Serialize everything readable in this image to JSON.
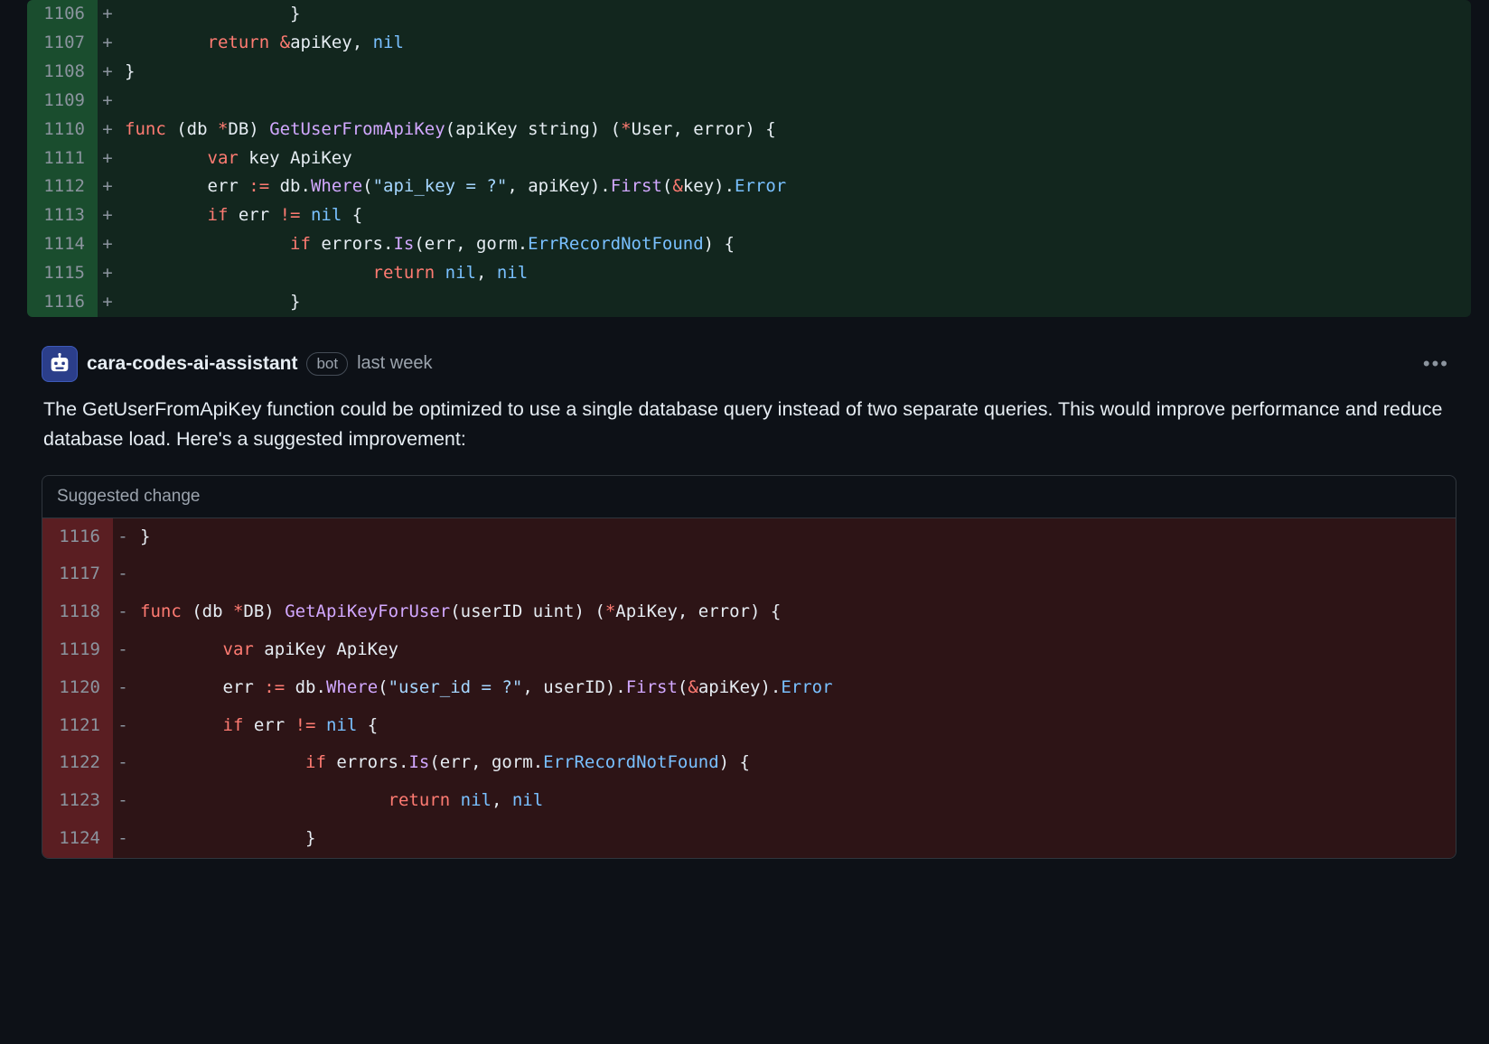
{
  "diff": {
    "lines": [
      {
        "num": "1106",
        "mark": "+",
        "cls": "added",
        "tokens": [
          {
            "t": "                }",
            "c": ""
          }
        ]
      },
      {
        "num": "1107",
        "mark": "+",
        "cls": "added",
        "tokens": [
          {
            "t": "        ",
            "c": ""
          },
          {
            "t": "return",
            "c": "tok-kw"
          },
          {
            "t": " ",
            "c": ""
          },
          {
            "t": "&",
            "c": "tok-op"
          },
          {
            "t": "apiKey, ",
            "c": ""
          },
          {
            "t": "nil",
            "c": "tok-id"
          }
        ]
      },
      {
        "num": "1108",
        "mark": "+",
        "cls": "added",
        "tokens": [
          {
            "t": "}",
            "c": ""
          }
        ]
      },
      {
        "num": "1109",
        "mark": "+",
        "cls": "added",
        "tokens": [
          {
            "t": "",
            "c": ""
          }
        ]
      },
      {
        "num": "1110",
        "mark": "+",
        "cls": "added",
        "tokens": [
          {
            "t": "func",
            "c": "tok-kw"
          },
          {
            "t": " (db ",
            "c": ""
          },
          {
            "t": "*",
            "c": "tok-op"
          },
          {
            "t": "DB) ",
            "c": ""
          },
          {
            "t": "GetUserFromApiKey",
            "c": "tok-fn"
          },
          {
            "t": "(apiKey string) (",
            "c": ""
          },
          {
            "t": "*",
            "c": "tok-op"
          },
          {
            "t": "User, error) {",
            "c": ""
          }
        ]
      },
      {
        "num": "1111",
        "mark": "+",
        "cls": "added",
        "tokens": [
          {
            "t": "        ",
            "c": ""
          },
          {
            "t": "var",
            "c": "tok-kw"
          },
          {
            "t": " key ApiKey",
            "c": ""
          }
        ]
      },
      {
        "num": "1112",
        "mark": "+",
        "cls": "added",
        "tokens": [
          {
            "t": "        err ",
            "c": ""
          },
          {
            "t": ":=",
            "c": "tok-op"
          },
          {
            "t": " db.",
            "c": ""
          },
          {
            "t": "Where",
            "c": "tok-fn"
          },
          {
            "t": "(",
            "c": ""
          },
          {
            "t": "\"api_key = ?\"",
            "c": "tok-str"
          },
          {
            "t": ", apiKey).",
            "c": ""
          },
          {
            "t": "First",
            "c": "tok-fn"
          },
          {
            "t": "(",
            "c": ""
          },
          {
            "t": "&",
            "c": "tok-op"
          },
          {
            "t": "key).",
            "c": ""
          },
          {
            "t": "Error",
            "c": "tok-id"
          }
        ]
      },
      {
        "num": "1113",
        "mark": "+",
        "cls": "added",
        "tokens": [
          {
            "t": "        ",
            "c": ""
          },
          {
            "t": "if",
            "c": "tok-kw"
          },
          {
            "t": " err ",
            "c": ""
          },
          {
            "t": "!=",
            "c": "tok-op"
          },
          {
            "t": " ",
            "c": ""
          },
          {
            "t": "nil",
            "c": "tok-id"
          },
          {
            "t": " {",
            "c": ""
          }
        ]
      },
      {
        "num": "1114",
        "mark": "+",
        "cls": "added",
        "tokens": [
          {
            "t": "                ",
            "c": ""
          },
          {
            "t": "if",
            "c": "tok-kw"
          },
          {
            "t": " errors.",
            "c": ""
          },
          {
            "t": "Is",
            "c": "tok-fn"
          },
          {
            "t": "(err, gorm.",
            "c": ""
          },
          {
            "t": "ErrRecordNotFound",
            "c": "tok-id"
          },
          {
            "t": ") {",
            "c": ""
          }
        ]
      },
      {
        "num": "1115",
        "mark": "+",
        "cls": "added",
        "tokens": [
          {
            "t": "                        ",
            "c": ""
          },
          {
            "t": "return",
            "c": "tok-kw"
          },
          {
            "t": " ",
            "c": ""
          },
          {
            "t": "nil",
            "c": "tok-id"
          },
          {
            "t": ", ",
            "c": ""
          },
          {
            "t": "nil",
            "c": "tok-id"
          }
        ]
      },
      {
        "num": "1116",
        "mark": "+",
        "cls": "added",
        "tokens": [
          {
            "t": "                }",
            "c": ""
          }
        ]
      }
    ]
  },
  "comment": {
    "author": "cara-codes-ai-assistant",
    "bot_label": "bot",
    "timestamp": "last week",
    "body": "The GetUserFromApiKey function could be optimized to use a single database query instead of two separate queries. This would improve performance and reduce database load. Here's a suggested improvement:",
    "suggestion_label": "Suggested change",
    "suggestion_lines": [
      {
        "num": "1116",
        "mark": "-",
        "cls": "removed",
        "tokens": [
          {
            "t": "}",
            "c": ""
          }
        ]
      },
      {
        "num": "1117",
        "mark": "-",
        "cls": "removed",
        "tokens": [
          {
            "t": "",
            "c": ""
          }
        ]
      },
      {
        "num": "1118",
        "mark": "-",
        "cls": "removed",
        "tokens": [
          {
            "t": "func",
            "c": "tok-kw"
          },
          {
            "t": " (db ",
            "c": ""
          },
          {
            "t": "*",
            "c": "tok-op"
          },
          {
            "t": "DB) ",
            "c": ""
          },
          {
            "t": "GetApiKeyForUser",
            "c": "tok-fn"
          },
          {
            "t": "(userID uint) (",
            "c": ""
          },
          {
            "t": "*",
            "c": "tok-op"
          },
          {
            "t": "ApiKey, error) {",
            "c": ""
          }
        ]
      },
      {
        "num": "1119",
        "mark": "-",
        "cls": "removed",
        "tokens": [
          {
            "t": "        ",
            "c": ""
          },
          {
            "t": "var",
            "c": "tok-kw"
          },
          {
            "t": " apiKey ApiKey",
            "c": ""
          }
        ]
      },
      {
        "num": "1120",
        "mark": "-",
        "cls": "removed",
        "tokens": [
          {
            "t": "        err ",
            "c": ""
          },
          {
            "t": ":=",
            "c": "tok-op"
          },
          {
            "t": " db.",
            "c": ""
          },
          {
            "t": "Where",
            "c": "tok-fn"
          },
          {
            "t": "(",
            "c": ""
          },
          {
            "t": "\"user_id = ?\"",
            "c": "tok-str"
          },
          {
            "t": ", userID).",
            "c": ""
          },
          {
            "t": "First",
            "c": "tok-fn"
          },
          {
            "t": "(",
            "c": ""
          },
          {
            "t": "&",
            "c": "tok-op"
          },
          {
            "t": "apiKey).",
            "c": ""
          },
          {
            "t": "Error",
            "c": "tok-id"
          }
        ]
      },
      {
        "num": "1121",
        "mark": "-",
        "cls": "removed",
        "tokens": [
          {
            "t": "        ",
            "c": ""
          },
          {
            "t": "if",
            "c": "tok-kw"
          },
          {
            "t": " err ",
            "c": ""
          },
          {
            "t": "!=",
            "c": "tok-op"
          },
          {
            "t": " ",
            "c": ""
          },
          {
            "t": "nil",
            "c": "tok-id"
          },
          {
            "t": " {",
            "c": ""
          }
        ]
      },
      {
        "num": "1122",
        "mark": "-",
        "cls": "removed",
        "tokens": [
          {
            "t": "                ",
            "c": ""
          },
          {
            "t": "if",
            "c": "tok-kw"
          },
          {
            "t": " errors.",
            "c": ""
          },
          {
            "t": "Is",
            "c": "tok-fn"
          },
          {
            "t": "(err, gorm.",
            "c": ""
          },
          {
            "t": "ErrRecordNotFound",
            "c": "tok-id"
          },
          {
            "t": ") {",
            "c": ""
          }
        ]
      },
      {
        "num": "1123",
        "mark": "-",
        "cls": "removed",
        "tokens": [
          {
            "t": "                        ",
            "c": ""
          },
          {
            "t": "return",
            "c": "tok-kw"
          },
          {
            "t": " ",
            "c": ""
          },
          {
            "t": "nil",
            "c": "tok-id"
          },
          {
            "t": ", ",
            "c": ""
          },
          {
            "t": "nil",
            "c": "tok-id"
          }
        ]
      },
      {
        "num": "1124",
        "mark": "-",
        "cls": "removed",
        "tokens": [
          {
            "t": "                }",
            "c": ""
          }
        ]
      }
    ]
  }
}
